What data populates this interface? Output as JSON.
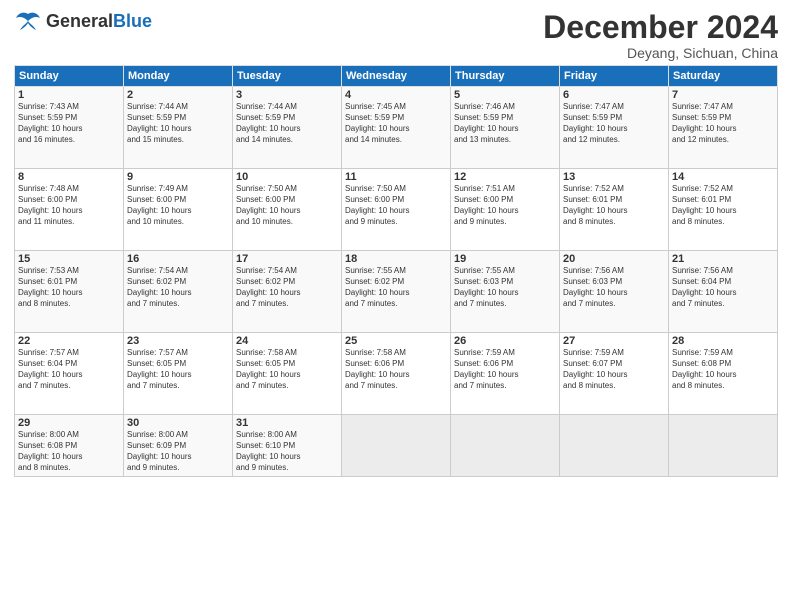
{
  "logo": {
    "general": "General",
    "blue": "Blue"
  },
  "title": "December 2024",
  "subtitle": "Deyang, Sichuan, China",
  "days_header": [
    "Sunday",
    "Monday",
    "Tuesday",
    "Wednesday",
    "Thursday",
    "Friday",
    "Saturday"
  ],
  "weeks": [
    [
      {
        "day": "1",
        "info": "Sunrise: 7:43 AM\nSunset: 5:59 PM\nDaylight: 10 hours\nand 16 minutes."
      },
      {
        "day": "2",
        "info": "Sunrise: 7:44 AM\nSunset: 5:59 PM\nDaylight: 10 hours\nand 15 minutes."
      },
      {
        "day": "3",
        "info": "Sunrise: 7:44 AM\nSunset: 5:59 PM\nDaylight: 10 hours\nand 14 minutes."
      },
      {
        "day": "4",
        "info": "Sunrise: 7:45 AM\nSunset: 5:59 PM\nDaylight: 10 hours\nand 14 minutes."
      },
      {
        "day": "5",
        "info": "Sunrise: 7:46 AM\nSunset: 5:59 PM\nDaylight: 10 hours\nand 13 minutes."
      },
      {
        "day": "6",
        "info": "Sunrise: 7:47 AM\nSunset: 5:59 PM\nDaylight: 10 hours\nand 12 minutes."
      },
      {
        "day": "7",
        "info": "Sunrise: 7:47 AM\nSunset: 5:59 PM\nDaylight: 10 hours\nand 12 minutes."
      }
    ],
    [
      {
        "day": "8",
        "info": "Sunrise: 7:48 AM\nSunset: 6:00 PM\nDaylight: 10 hours\nand 11 minutes."
      },
      {
        "day": "9",
        "info": "Sunrise: 7:49 AM\nSunset: 6:00 PM\nDaylight: 10 hours\nand 10 minutes."
      },
      {
        "day": "10",
        "info": "Sunrise: 7:50 AM\nSunset: 6:00 PM\nDaylight: 10 hours\nand 10 minutes."
      },
      {
        "day": "11",
        "info": "Sunrise: 7:50 AM\nSunset: 6:00 PM\nDaylight: 10 hours\nand 9 minutes."
      },
      {
        "day": "12",
        "info": "Sunrise: 7:51 AM\nSunset: 6:00 PM\nDaylight: 10 hours\nand 9 minutes."
      },
      {
        "day": "13",
        "info": "Sunrise: 7:52 AM\nSunset: 6:01 PM\nDaylight: 10 hours\nand 8 minutes."
      },
      {
        "day": "14",
        "info": "Sunrise: 7:52 AM\nSunset: 6:01 PM\nDaylight: 10 hours\nand 8 minutes."
      }
    ],
    [
      {
        "day": "15",
        "info": "Sunrise: 7:53 AM\nSunset: 6:01 PM\nDaylight: 10 hours\nand 8 minutes."
      },
      {
        "day": "16",
        "info": "Sunrise: 7:54 AM\nSunset: 6:02 PM\nDaylight: 10 hours\nand 7 minutes."
      },
      {
        "day": "17",
        "info": "Sunrise: 7:54 AM\nSunset: 6:02 PM\nDaylight: 10 hours\nand 7 minutes."
      },
      {
        "day": "18",
        "info": "Sunrise: 7:55 AM\nSunset: 6:02 PM\nDaylight: 10 hours\nand 7 minutes."
      },
      {
        "day": "19",
        "info": "Sunrise: 7:55 AM\nSunset: 6:03 PM\nDaylight: 10 hours\nand 7 minutes."
      },
      {
        "day": "20",
        "info": "Sunrise: 7:56 AM\nSunset: 6:03 PM\nDaylight: 10 hours\nand 7 minutes."
      },
      {
        "day": "21",
        "info": "Sunrise: 7:56 AM\nSunset: 6:04 PM\nDaylight: 10 hours\nand 7 minutes."
      }
    ],
    [
      {
        "day": "22",
        "info": "Sunrise: 7:57 AM\nSunset: 6:04 PM\nDaylight: 10 hours\nand 7 minutes."
      },
      {
        "day": "23",
        "info": "Sunrise: 7:57 AM\nSunset: 6:05 PM\nDaylight: 10 hours\nand 7 minutes."
      },
      {
        "day": "24",
        "info": "Sunrise: 7:58 AM\nSunset: 6:05 PM\nDaylight: 10 hours\nand 7 minutes."
      },
      {
        "day": "25",
        "info": "Sunrise: 7:58 AM\nSunset: 6:06 PM\nDaylight: 10 hours\nand 7 minutes."
      },
      {
        "day": "26",
        "info": "Sunrise: 7:59 AM\nSunset: 6:06 PM\nDaylight: 10 hours\nand 7 minutes."
      },
      {
        "day": "27",
        "info": "Sunrise: 7:59 AM\nSunset: 6:07 PM\nDaylight: 10 hours\nand 8 minutes."
      },
      {
        "day": "28",
        "info": "Sunrise: 7:59 AM\nSunset: 6:08 PM\nDaylight: 10 hours\nand 8 minutes."
      }
    ],
    [
      {
        "day": "29",
        "info": "Sunrise: 8:00 AM\nSunset: 6:08 PM\nDaylight: 10 hours\nand 8 minutes."
      },
      {
        "day": "30",
        "info": "Sunrise: 8:00 AM\nSunset: 6:09 PM\nDaylight: 10 hours\nand 9 minutes."
      },
      {
        "day": "31",
        "info": "Sunrise: 8:00 AM\nSunset: 6:10 PM\nDaylight: 10 hours\nand 9 minutes."
      },
      {
        "day": "",
        "info": ""
      },
      {
        "day": "",
        "info": ""
      },
      {
        "day": "",
        "info": ""
      },
      {
        "day": "",
        "info": ""
      }
    ]
  ]
}
